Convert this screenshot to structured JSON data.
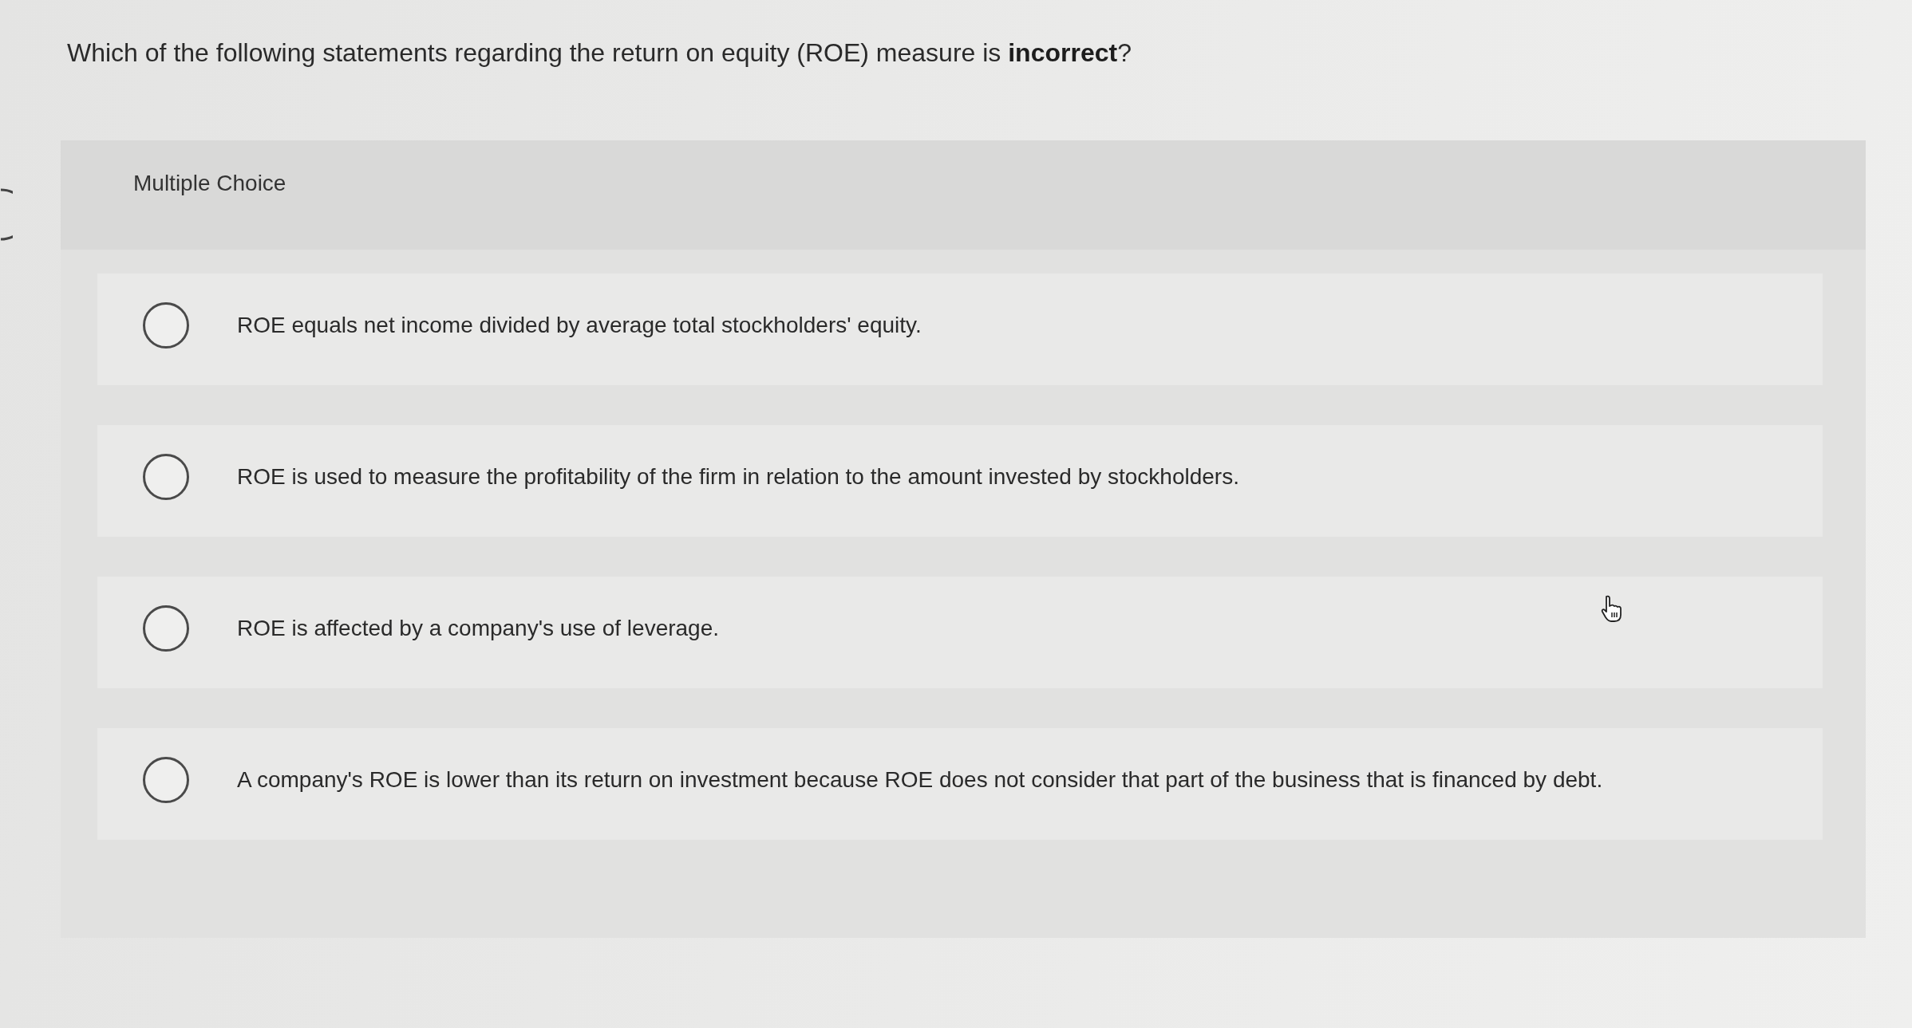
{
  "question": {
    "text": "Which of the following statements regarding the return on equity (ROE) measure is **incorrect**?"
  },
  "multiple_choice": {
    "heading": "Multiple Choice",
    "options": [
      {
        "text": "ROE equals net income divided by average total stockholders' equity.",
        "selected": false
      },
      {
        "text": "ROE is used to measure the profitability of the firm in relation to the amount invested by stockholders.",
        "selected": false
      },
      {
        "text": "ROE is affected by a company's use of leverage.",
        "selected": false
      },
      {
        "text": "A company's ROE is lower than its return on investment because ROE does not consider that part of the business that is financed by debt.",
        "selected": false
      }
    ]
  }
}
